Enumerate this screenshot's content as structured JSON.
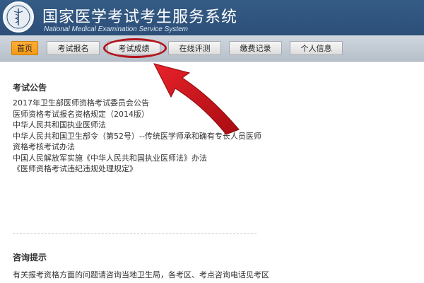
{
  "header": {
    "title": "国家医学考试考生服务系统",
    "subtitle": "National Medical Examination Service System",
    "brand_color": "#2c4f78"
  },
  "nav": {
    "active_color": "#f39a13",
    "items": [
      {
        "label": "首页",
        "active": true
      },
      {
        "label": "考试报名",
        "active": false
      },
      {
        "label": "考试成绩",
        "active": false,
        "highlighted": true
      },
      {
        "label": "在线评测",
        "active": false
      },
      {
        "label": "缴费记录",
        "active": false
      },
      {
        "label": "个人信息",
        "active": false
      }
    ]
  },
  "annotation": {
    "color": "#b4141c",
    "icon": "red-arrow-icon"
  },
  "notices": {
    "heading": "考试公告",
    "items": [
      "2017年卫生部医师资格考试委员会公告",
      "医师资格考试报名资格规定（2014版）",
      "中华人民共和国执业医师法",
      "中华人民共和国卫生部令（第52号）--传统医学师承和确有专长人员医师资格考核考试办法",
      "中国人民解放军实施《中华人民共和国执业医师法》办法",
      "《医师资格考试违纪违规处理规定》"
    ]
  },
  "consult": {
    "heading": "咨询提示",
    "text": "有关报考资格方面的问题请咨询当地卫生局，各考区、考点咨询电话见考区"
  }
}
